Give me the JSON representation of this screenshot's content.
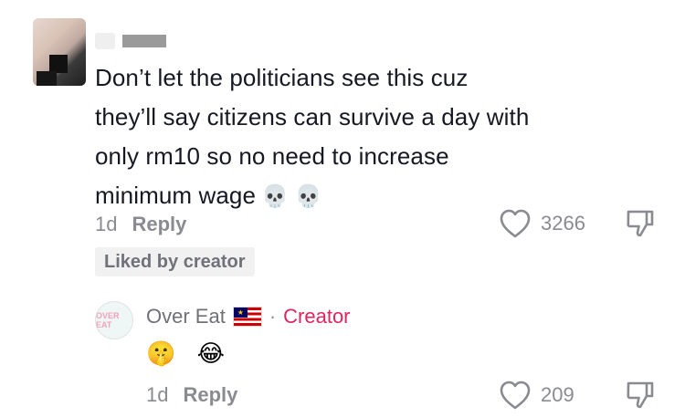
{
  "comment": {
    "lines": [
      "Don’t let the politicians see this cuz",
      "they’ll say citizens can survive a day with",
      "only rm10 so no need to increase",
      "minimum wage"
    ],
    "emoji": "💀 💀",
    "age": "1d",
    "reply_label": "Reply",
    "like_count": "3266",
    "liked_by_badge": "Liked by creator"
  },
  "reply": {
    "avatar_text": "OVER EAT",
    "author": "Over Eat",
    "separator": "·",
    "creator_label": "Creator",
    "emoji": "🤫 😂",
    "age": "1d",
    "reply_label": "Reply",
    "like_count": "209"
  },
  "colors": {
    "text": "#161823",
    "muted": "#8a8b91",
    "creator_accent": "#e0245e",
    "badge_bg": "#f1f1f2"
  },
  "icons": {
    "like": "heart-outline-icon",
    "dislike": "thumbs-down-icon",
    "flag": "malaysia-flag-icon"
  }
}
